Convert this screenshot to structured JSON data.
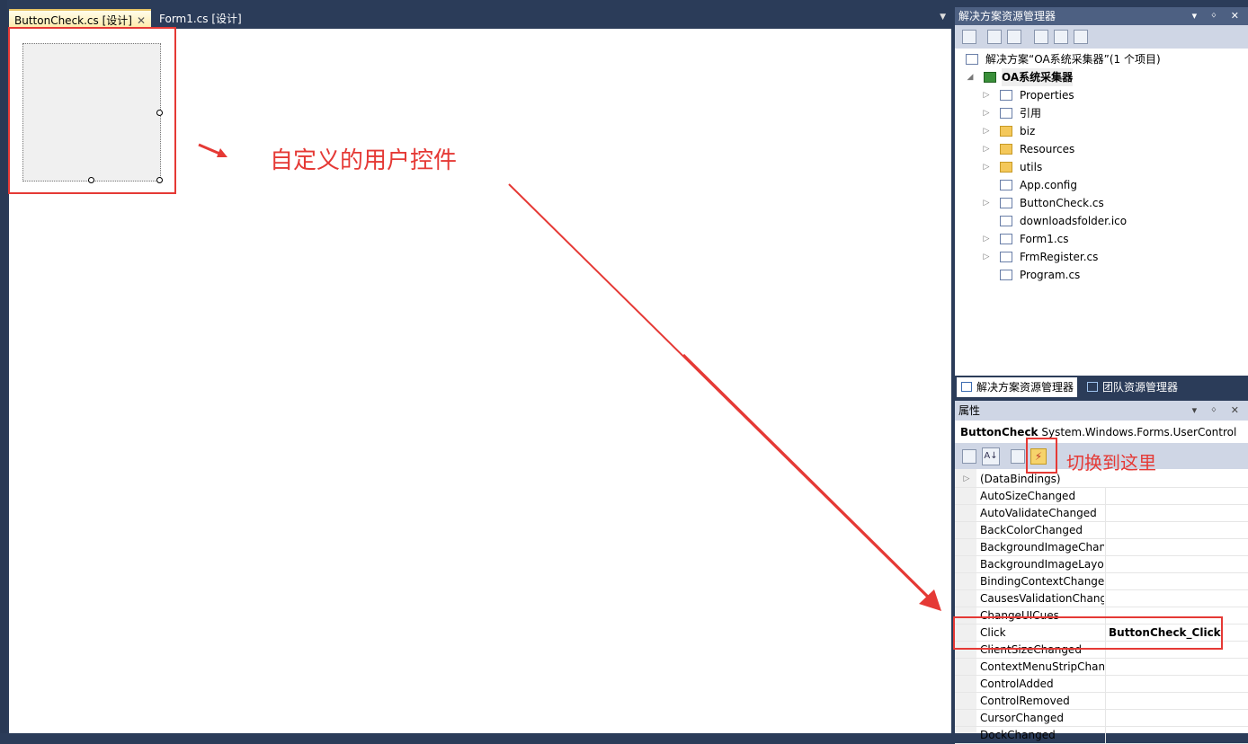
{
  "tabs": {
    "active_label": "ButtonCheck.cs [设计]",
    "other_label": "Form1.cs [设计]",
    "close_glyph": "✕",
    "dropdown_glyph": "▼"
  },
  "annotations": {
    "user_control_label": "自定义的用户控件",
    "switch_label": "切换到这里"
  },
  "solution_explorer": {
    "title": "解决方案资源管理器",
    "title_icons": "▾ ᛜ ✕",
    "solution_line": "解决方案“OA系统采集器”(1 个项目)",
    "project": "OA系统采集器",
    "items": [
      {
        "label": "Properties",
        "icon": "properties-icon",
        "expandable": true
      },
      {
        "label": "引用",
        "icon": "references-icon",
        "expandable": true
      },
      {
        "label": "biz",
        "icon": "folder-icon",
        "expandable": true
      },
      {
        "label": "Resources",
        "icon": "folder-icon",
        "expandable": true
      },
      {
        "label": "utils",
        "icon": "folder-icon",
        "expandable": true
      },
      {
        "label": "App.config",
        "icon": "config-file-icon",
        "expandable": false
      },
      {
        "label": "ButtonCheck.cs",
        "icon": "usercontrol-file-icon",
        "expandable": true
      },
      {
        "label": "downloadsfolder.ico",
        "icon": "ico-file-icon",
        "expandable": false
      },
      {
        "label": "Form1.cs",
        "icon": "form-file-icon",
        "expandable": true
      },
      {
        "label": "FrmRegister.cs",
        "icon": "form-file-icon",
        "expandable": true
      },
      {
        "label": "Program.cs",
        "icon": "cs-file-icon",
        "expandable": false
      }
    ],
    "bottom_tabs": [
      "解决方案资源管理器",
      "团队资源管理器"
    ]
  },
  "properties": {
    "title": "属性",
    "object_name": "ButtonCheck",
    "object_type": "System.Windows.Forms.UserControl",
    "rows": [
      {
        "name": "(DataBindings)",
        "value": ""
      },
      {
        "name": "AutoSizeChanged",
        "value": ""
      },
      {
        "name": "AutoValidateChanged",
        "value": ""
      },
      {
        "name": "BackColorChanged",
        "value": ""
      },
      {
        "name": "BackgroundImageChan",
        "value": ""
      },
      {
        "name": "BackgroundImageLayou",
        "value": ""
      },
      {
        "name": "BindingContextChangec",
        "value": ""
      },
      {
        "name": "CausesValidationChang",
        "value": ""
      },
      {
        "name": "ChangeUICues",
        "value": ""
      },
      {
        "name": "Click",
        "value": "ButtonCheck_Click"
      },
      {
        "name": "ClientSizeChanged",
        "value": ""
      },
      {
        "name": "ContextMenuStripChang",
        "value": ""
      },
      {
        "name": "ControlAdded",
        "value": ""
      },
      {
        "name": "ControlRemoved",
        "value": ""
      },
      {
        "name": "CursorChanged",
        "value": ""
      },
      {
        "name": "DockChanged",
        "value": ""
      }
    ]
  },
  "colors": {
    "annotation_red": "#e53935",
    "chrome_dark": "#2b3c59",
    "pane_title": "#4d6082"
  }
}
